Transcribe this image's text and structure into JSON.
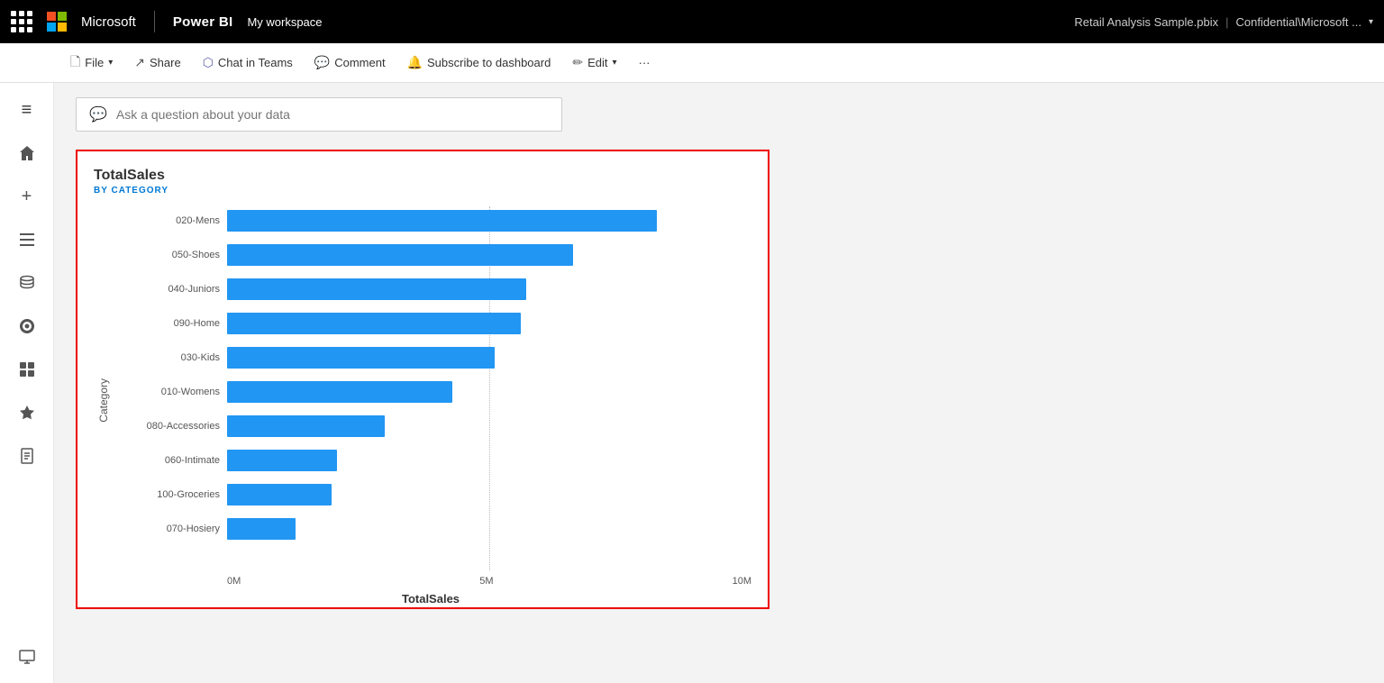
{
  "topbar": {
    "app_grid_label": "App grid",
    "microsoft_label": "Microsoft",
    "powerbi_label": "Power BI",
    "workspace_label": "My workspace",
    "file_name": "Retail Analysis Sample.pbix",
    "confidential_label": "Confidential\\Microsoft ...",
    "chevron_label": "▾"
  },
  "toolbar": {
    "file_label": "File",
    "share_label": "Share",
    "chat_label": "Chat in Teams",
    "comment_label": "Comment",
    "subscribe_label": "Subscribe to dashboard",
    "edit_label": "Edit",
    "more_label": "···"
  },
  "sidebar": {
    "items": [
      {
        "name": "hamburger",
        "icon": "≡"
      },
      {
        "name": "home",
        "icon": "⌂"
      },
      {
        "name": "create",
        "icon": "+"
      },
      {
        "name": "browse",
        "icon": "☰"
      },
      {
        "name": "data-hub",
        "icon": "🗄"
      },
      {
        "name": "goals",
        "icon": "🏆"
      },
      {
        "name": "apps",
        "icon": "⊞"
      },
      {
        "name": "learn",
        "icon": "🚀"
      },
      {
        "name": "docs",
        "icon": "📖"
      },
      {
        "name": "workspace",
        "icon": "🖥"
      }
    ]
  },
  "qa": {
    "placeholder": "Ask a question about your data",
    "icon": "💬"
  },
  "chart": {
    "title": "TotalSales",
    "subtitle": "BY CATEGORY",
    "y_axis_label": "Category",
    "x_axis_label": "TotalSales",
    "x_axis_ticks": [
      "0M",
      "5M",
      "10M"
    ],
    "max_value": 10000000,
    "bars": [
      {
        "label": "020-Mens",
        "value": 8200000
      },
      {
        "label": "050-Shoes",
        "value": 6600000
      },
      {
        "label": "040-Juniors",
        "value": 5700000
      },
      {
        "label": "090-Home",
        "value": 5600000
      },
      {
        "label": "030-Kids",
        "value": 5100000
      },
      {
        "label": "010-Womens",
        "value": 4300000
      },
      {
        "label": "080-Accessories",
        "value": 3000000
      },
      {
        "label": "060-Intimate",
        "value": 2100000
      },
      {
        "label": "100-Groceries",
        "value": 2000000
      },
      {
        "label": "070-Hosiery",
        "value": 1300000
      }
    ],
    "bar_color": "#2196f3",
    "gridline_positions": [
      0.5
    ]
  }
}
